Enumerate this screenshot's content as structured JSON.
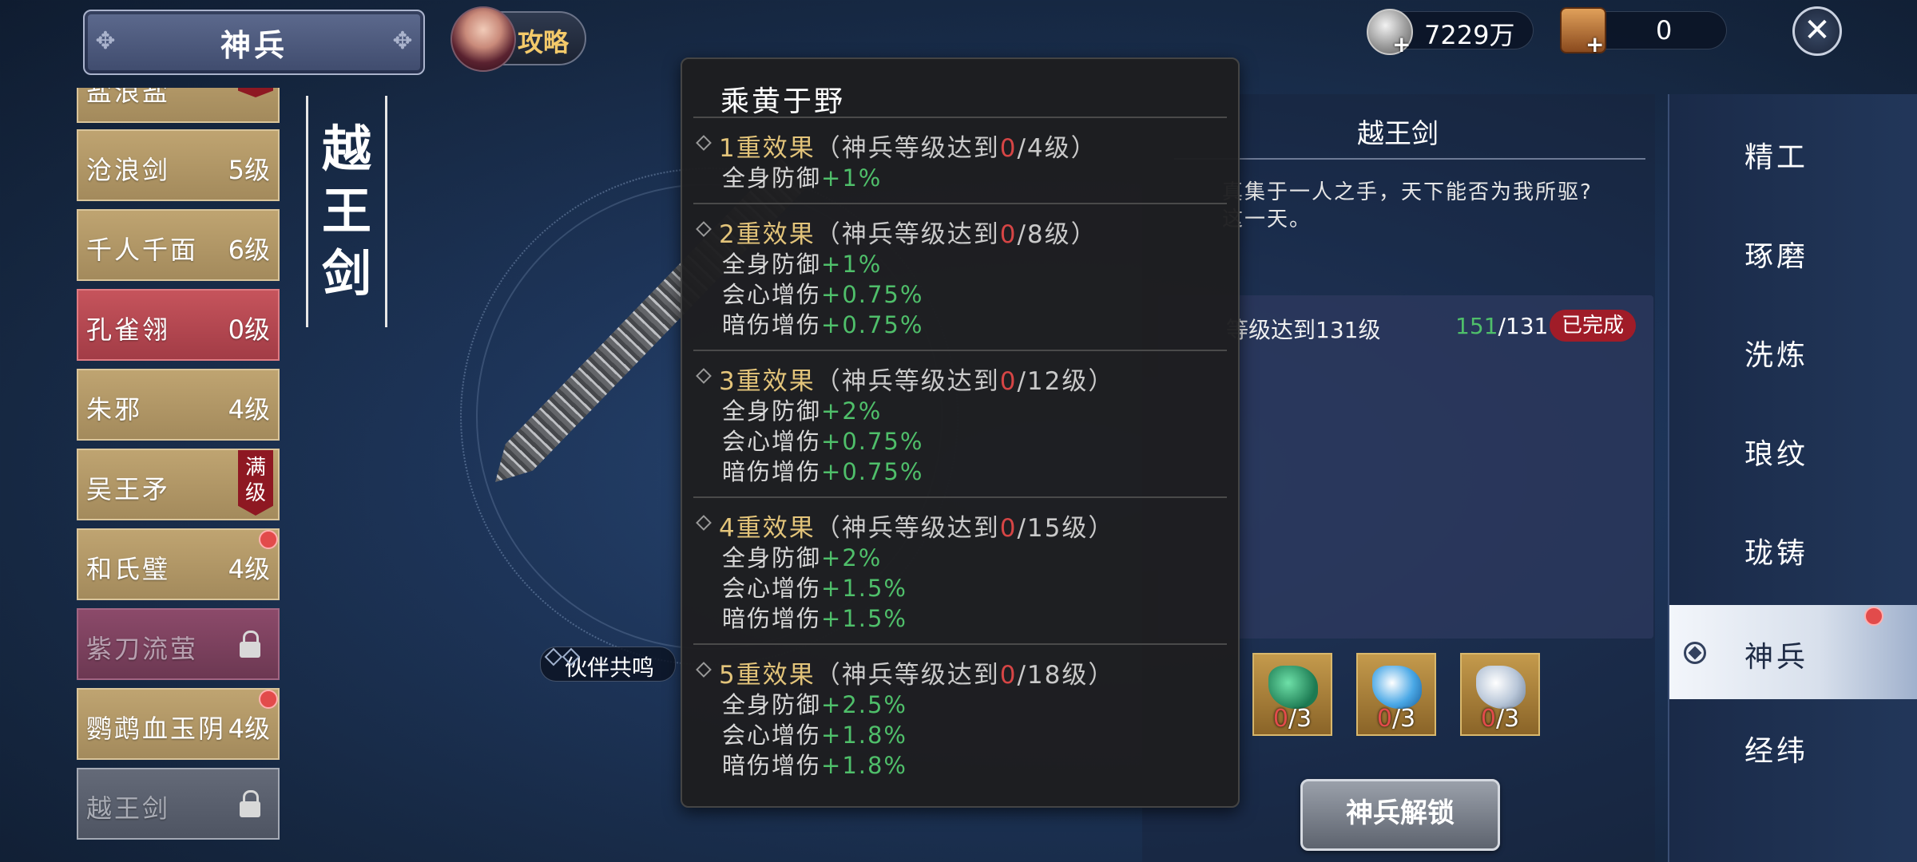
{
  "header": {
    "title": "神兵",
    "guide_label": "攻略",
    "currency_silver": "7229万",
    "currency_chest": "0"
  },
  "weapon_list": [
    {
      "name": "盐浪盐",
      "level": "",
      "badge": "级",
      "state": "gold"
    },
    {
      "name": "沧浪剑",
      "level": "5级",
      "state": "gold"
    },
    {
      "name": "千人千面",
      "level": "6级",
      "state": "gold"
    },
    {
      "name": "孔雀翎",
      "level": "0级",
      "state": "red"
    },
    {
      "name": "朱邪",
      "level": "4级",
      "state": "gold"
    },
    {
      "name": "吴王矛",
      "level": "",
      "badge": "满级",
      "state": "gold"
    },
    {
      "name": "和氏璧",
      "level": "4级",
      "state": "gold",
      "dot": true
    },
    {
      "name": "紫刀流萤",
      "level": "",
      "state": "locked"
    },
    {
      "name": "鹦鹉血玉阴",
      "level": "4级",
      "state": "gold",
      "dot": true
    },
    {
      "name": "越王剑",
      "level": "",
      "state": "locked-selected"
    }
  ],
  "vertical_name": [
    "越",
    "王",
    "剑"
  ],
  "partner_label": "伙伴共鸣",
  "info": {
    "title": "越王剑",
    "desc_line1": "真集于一人之手，天下能否为我所驱?",
    "desc_line2": "这一天。",
    "req_text": "等级达到131级",
    "req_current": "151",
    "req_total": "/131",
    "req_status": "已完成",
    "materials": [
      {
        "have": "0",
        "need": "/3",
        "icon": "green-ore-icon"
      },
      {
        "have": "0",
        "need": "/3",
        "icon": "wave-crystal-icon"
      },
      {
        "have": "0",
        "need": "/3",
        "icon": "silver-ore-icon"
      }
    ],
    "unlock_label": "神兵解锁"
  },
  "menu": [
    {
      "label": "精工",
      "active": false
    },
    {
      "label": "琢磨",
      "active": false
    },
    {
      "label": "洗炼",
      "active": false
    },
    {
      "label": "琅纹",
      "active": false
    },
    {
      "label": "珑铸",
      "active": false
    },
    {
      "label": "神兵",
      "active": true,
      "dot": true
    },
    {
      "label": "经纬",
      "active": false
    }
  ],
  "popup": {
    "title": "乘黄于野",
    "tiers": [
      {
        "head": "1重效果",
        "cond_pre": "（神兵等级达到",
        "cur": "0",
        "cond_post": "/4级）",
        "stats": [
          {
            "name": "全身防御",
            "val": "+1%"
          }
        ]
      },
      {
        "head": "2重效果",
        "cond_pre": "（神兵等级达到",
        "cur": "0",
        "cond_post": "/8级）",
        "stats": [
          {
            "name": "全身防御",
            "val": "+1%"
          },
          {
            "name": "会心增伤",
            "val": "+0.75%"
          },
          {
            "name": "暗伤增伤",
            "val": "+0.75%"
          }
        ]
      },
      {
        "head": "3重效果",
        "cond_pre": "（神兵等级达到",
        "cur": "0",
        "cond_post": "/12级）",
        "stats": [
          {
            "name": "全身防御",
            "val": "+2%"
          },
          {
            "name": "会心增伤",
            "val": "+0.75%"
          },
          {
            "name": "暗伤增伤",
            "val": "+0.75%"
          }
        ]
      },
      {
        "head": "4重效果",
        "cond_pre": "（神兵等级达到",
        "cur": "0",
        "cond_post": "/15级）",
        "stats": [
          {
            "name": "全身防御",
            "val": "+2%"
          },
          {
            "name": "会心增伤",
            "val": "+1.5%"
          },
          {
            "name": "暗伤增伤",
            "val": "+1.5%"
          }
        ]
      },
      {
        "head": "5重效果",
        "cond_pre": "（神兵等级达到",
        "cur": "0",
        "cond_post": "/18级）",
        "stats": [
          {
            "name": "全身防御",
            "val": "+2.5%"
          },
          {
            "name": "会心增伤",
            "val": "+1.8%"
          },
          {
            "name": "暗伤增伤",
            "val": "+1.8%"
          }
        ]
      }
    ]
  },
  "colors": {
    "accent_gold": "#e3c47a",
    "stat_green": "#4fbf6a",
    "alert_red": "#d64545"
  }
}
